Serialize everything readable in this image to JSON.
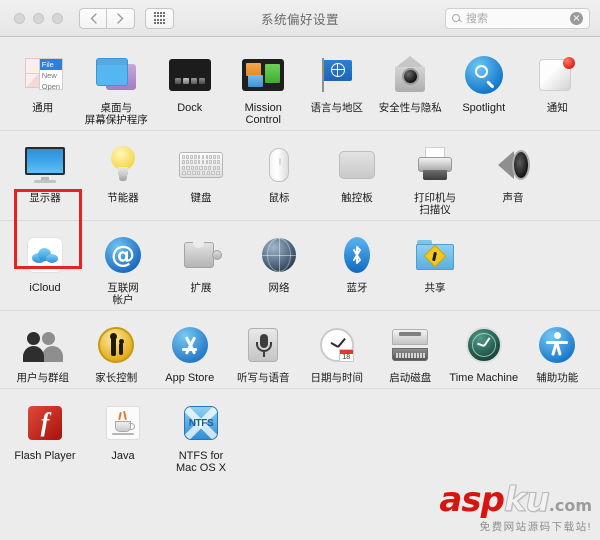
{
  "window": {
    "title": "系统偏好设置",
    "traffic_lights": [
      "close",
      "minimize",
      "zoom"
    ],
    "nav": {
      "back_label": "‹",
      "forward_label": "›",
      "grid_label": "show-all"
    },
    "search": {
      "placeholder": "搜索",
      "value": "",
      "clear_label": "×"
    }
  },
  "colors": {
    "highlight": "#e8221f",
    "accent_blue": "#2f8fd8",
    "window_bg": "#ececec",
    "titlebar_bg": "#ececec"
  },
  "rows": [
    {
      "items": [
        {
          "label": "通用",
          "icon": "general-icon"
        },
        {
          "label": "桌面与\n屏幕保护程序",
          "icon": "desktop-screensaver-icon"
        },
        {
          "label": "Dock",
          "icon": "dock-icon",
          "en": true
        },
        {
          "label": "Mission\nControl",
          "icon": "mission-control-icon",
          "en": true
        },
        {
          "label": "语言与地区",
          "icon": "language-region-icon"
        },
        {
          "label": "安全性与隐私",
          "icon": "security-privacy-icon"
        },
        {
          "label": "Spotlight",
          "icon": "spotlight-icon",
          "en": true
        },
        {
          "label": "通知",
          "icon": "notifications-icon"
        }
      ]
    },
    {
      "items": [
        {
          "label": "显示器",
          "icon": "displays-icon",
          "selected": true
        },
        {
          "label": "节能器",
          "icon": "energy-saver-icon"
        },
        {
          "label": "键盘",
          "icon": "keyboard-icon"
        },
        {
          "label": "鼠标",
          "icon": "mouse-icon"
        },
        {
          "label": "触控板",
          "icon": "trackpad-icon"
        },
        {
          "label": "打印机与\n扫描仪",
          "icon": "printers-scanners-icon"
        },
        {
          "label": "声音",
          "icon": "sound-icon"
        }
      ]
    },
    {
      "items": [
        {
          "label": "iCloud",
          "icon": "icloud-icon",
          "en": true
        },
        {
          "label": "互联网\n帐户",
          "icon": "internet-accounts-icon"
        },
        {
          "label": "扩展",
          "icon": "extensions-icon"
        },
        {
          "label": "网络",
          "icon": "network-icon"
        },
        {
          "label": "蓝牙",
          "icon": "bluetooth-icon"
        },
        {
          "label": "共享",
          "icon": "sharing-icon"
        }
      ]
    },
    {
      "items": [
        {
          "label": "用户与群组",
          "icon": "users-groups-icon"
        },
        {
          "label": "家长控制",
          "icon": "parental-controls-icon"
        },
        {
          "label": "App Store",
          "icon": "app-store-icon",
          "en": true
        },
        {
          "label": "听写与语音",
          "icon": "dictation-speech-icon"
        },
        {
          "label": "日期与时间",
          "icon": "date-time-icon"
        },
        {
          "label": "启动磁盘",
          "icon": "startup-disk-icon"
        },
        {
          "label": "Time Machine",
          "icon": "time-machine-icon",
          "en": true
        },
        {
          "label": "辅助功能",
          "icon": "accessibility-icon"
        }
      ]
    },
    {
      "items": [
        {
          "label": "Flash Player",
          "icon": "flash-player-icon",
          "en": true
        },
        {
          "label": "Java",
          "icon": "java-icon",
          "en": true
        },
        {
          "label": "NTFS for\nMac OS X",
          "icon": "ntfs-icon",
          "en": true
        }
      ]
    }
  ],
  "watermark": {
    "part1": "asp",
    "part2": "ku",
    "part3": ".com",
    "subtitle": "免费网站源码下载站!"
  },
  "icon_glyphs": {
    "at": "@",
    "bluetooth": "ᛒ",
    "flash": "f",
    "ntfs": "NTFS",
    "calendar_day": "18"
  }
}
